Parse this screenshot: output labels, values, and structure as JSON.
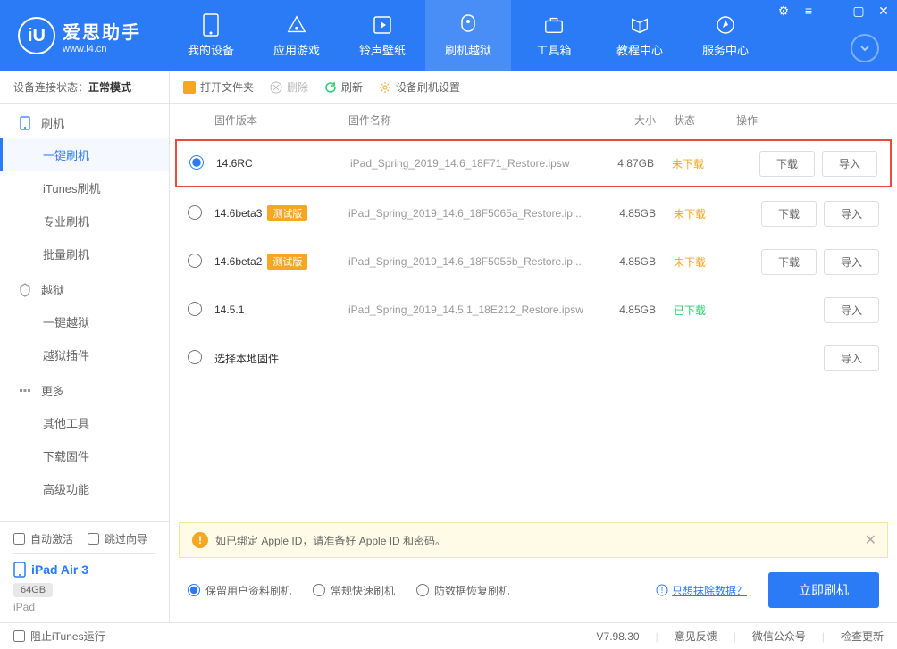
{
  "logo": {
    "main": "爱思助手",
    "sub": "www.i4.cn",
    "glyph": "iU"
  },
  "nav": [
    {
      "label": "我的设备"
    },
    {
      "label": "应用游戏"
    },
    {
      "label": "铃声壁纸"
    },
    {
      "label": "刷机越狱"
    },
    {
      "label": "工具箱"
    },
    {
      "label": "教程中心"
    },
    {
      "label": "服务中心"
    }
  ],
  "status": {
    "prefix": "设备连接状态：",
    "value": "正常模式"
  },
  "sidebar": {
    "groups": [
      {
        "title": "刷机",
        "items": [
          "一键刷机",
          "iTunes刷机",
          "专业刷机",
          "批量刷机"
        ]
      },
      {
        "title": "越狱",
        "items": [
          "一键越狱",
          "越狱插件"
        ]
      },
      {
        "title": "更多",
        "items": [
          "其他工具",
          "下载固件",
          "高级功能"
        ]
      }
    ],
    "auto_activate": "自动激活",
    "skip_guide": "跳过向导"
  },
  "device": {
    "name": "iPad Air 3",
    "storage": "64GB",
    "type": "iPad"
  },
  "toolbar": {
    "open_folder": "打开文件夹",
    "delete": "删除",
    "refresh": "刷新",
    "settings": "设备刷机设置"
  },
  "columns": {
    "version": "固件版本",
    "name": "固件名称",
    "size": "大小",
    "status": "状态",
    "action": "操作"
  },
  "firmware": [
    {
      "version": "14.6RC",
      "beta": false,
      "name": "iPad_Spring_2019_14.6_18F71_Restore.ipsw",
      "size": "4.87GB",
      "status": "未下载",
      "status_class": "not",
      "selected": true
    },
    {
      "version": "14.6beta3",
      "beta": true,
      "name": "iPad_Spring_2019_14.6_18F5065a_Restore.ip...",
      "size": "4.85GB",
      "status": "未下载",
      "status_class": "not",
      "selected": false
    },
    {
      "version": "14.6beta2",
      "beta": true,
      "name": "iPad_Spring_2019_14.6_18F5055b_Restore.ip...",
      "size": "4.85GB",
      "status": "未下载",
      "status_class": "not",
      "selected": false
    },
    {
      "version": "14.5.1",
      "beta": false,
      "name": "iPad_Spring_2019_14.5.1_18E212_Restore.ipsw",
      "size": "4.85GB",
      "status": "已下载",
      "status_class": "done",
      "selected": false
    }
  ],
  "local_firmware": "选择本地固件",
  "beta_label": "测试版",
  "btn_download": "下载",
  "btn_import": "导入",
  "warning": "如已绑定 Apple ID，请准备好 Apple ID 和密码。",
  "options": {
    "keep_data": "保留用户资料刷机",
    "normal": "常规快速刷机",
    "anti_recovery": "防数据恢复刷机",
    "wipe_link": "只想抹除数据？",
    "flash_now": "立即刷机"
  },
  "footer": {
    "block_itunes": "阻止iTunes运行",
    "version": "V7.98.30",
    "feedback": "意见反馈",
    "wechat": "微信公众号",
    "update": "检查更新"
  }
}
